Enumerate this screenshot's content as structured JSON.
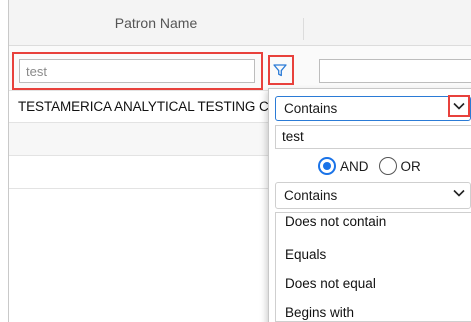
{
  "grid": {
    "column_header": "Patron Name",
    "filter_value": "test",
    "rows": [
      "TESTAMERICA ANALYTICAL TESTING CORP",
      "",
      ""
    ]
  },
  "filter_popup": {
    "operator_1": "Contains",
    "value_1": "test",
    "logic": {
      "and_label": "AND",
      "or_label": "OR",
      "selected": "AND"
    },
    "operator_2": "Contains",
    "operator_options": [
      "Does not contain",
      "Equals",
      "Does not equal",
      "Begins with"
    ]
  },
  "colors": {
    "highlight": "#e8413c",
    "accent": "#1a73e8",
    "funnel": "#2b7bd6"
  },
  "icons": {
    "filter": "funnel-icon",
    "dropdown": "chevron-down-icon"
  }
}
